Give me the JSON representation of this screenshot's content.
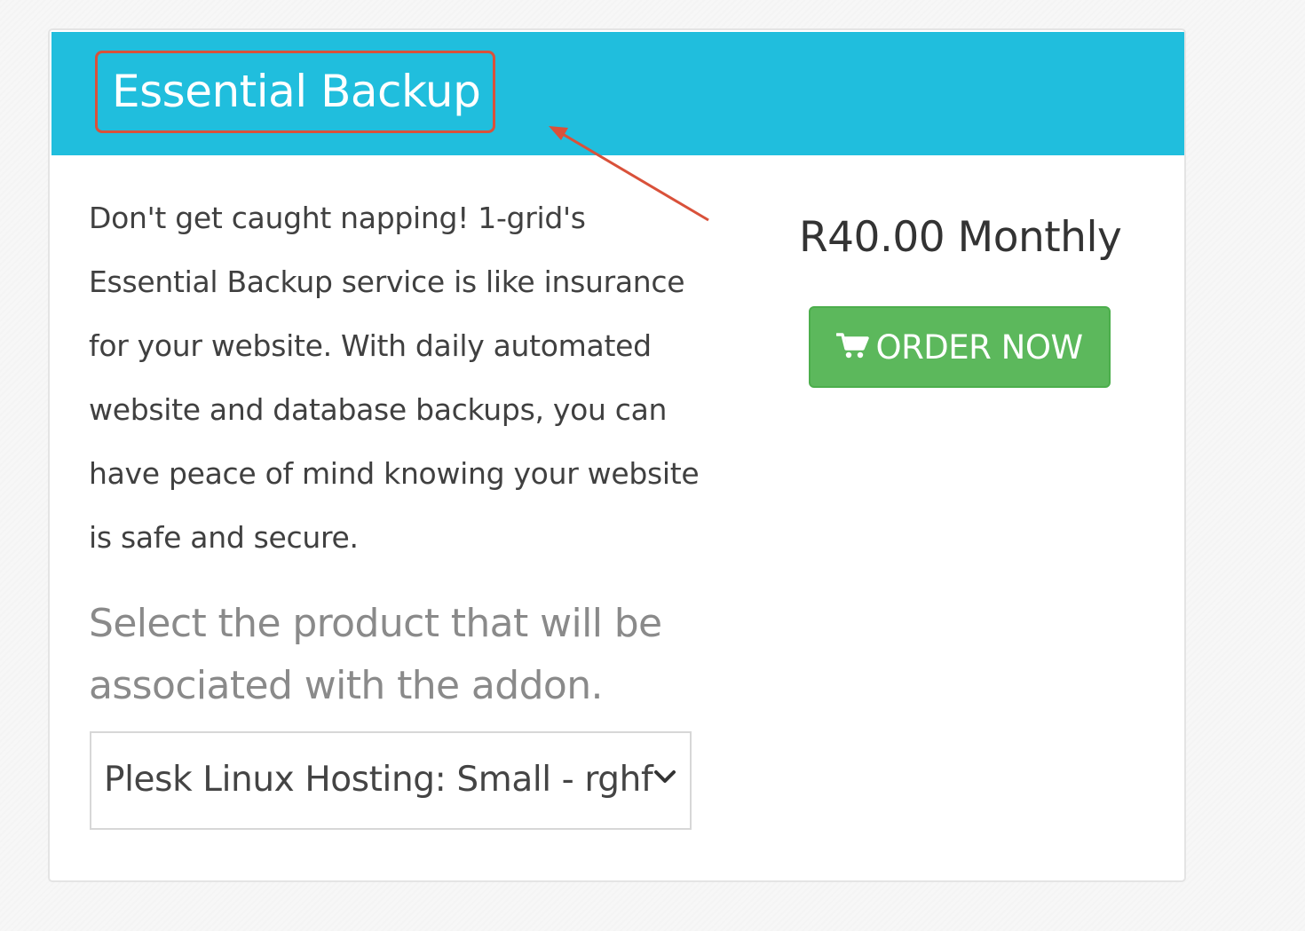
{
  "addon": {
    "title": "Essential Backup",
    "description": "Don't get caught napping! 1-grid's Essential Backup service is like insurance for your website. With daily automated website and database backups, you can have peace of mind knowing your website is safe and secure.",
    "select_label": "Select the product that will be associated with the addon.",
    "selected_product": "Plesk Linux Hosting: Small - rghf",
    "price": "R40.00 Monthly",
    "order_button_label": "ORDER NOW"
  },
  "icons": {
    "order_button": "shopping-cart-icon",
    "select": "chevron-down-icon"
  },
  "colors": {
    "header_background": "#20bedd",
    "order_button": "#5cb85c",
    "annotation": "#d9513a"
  }
}
